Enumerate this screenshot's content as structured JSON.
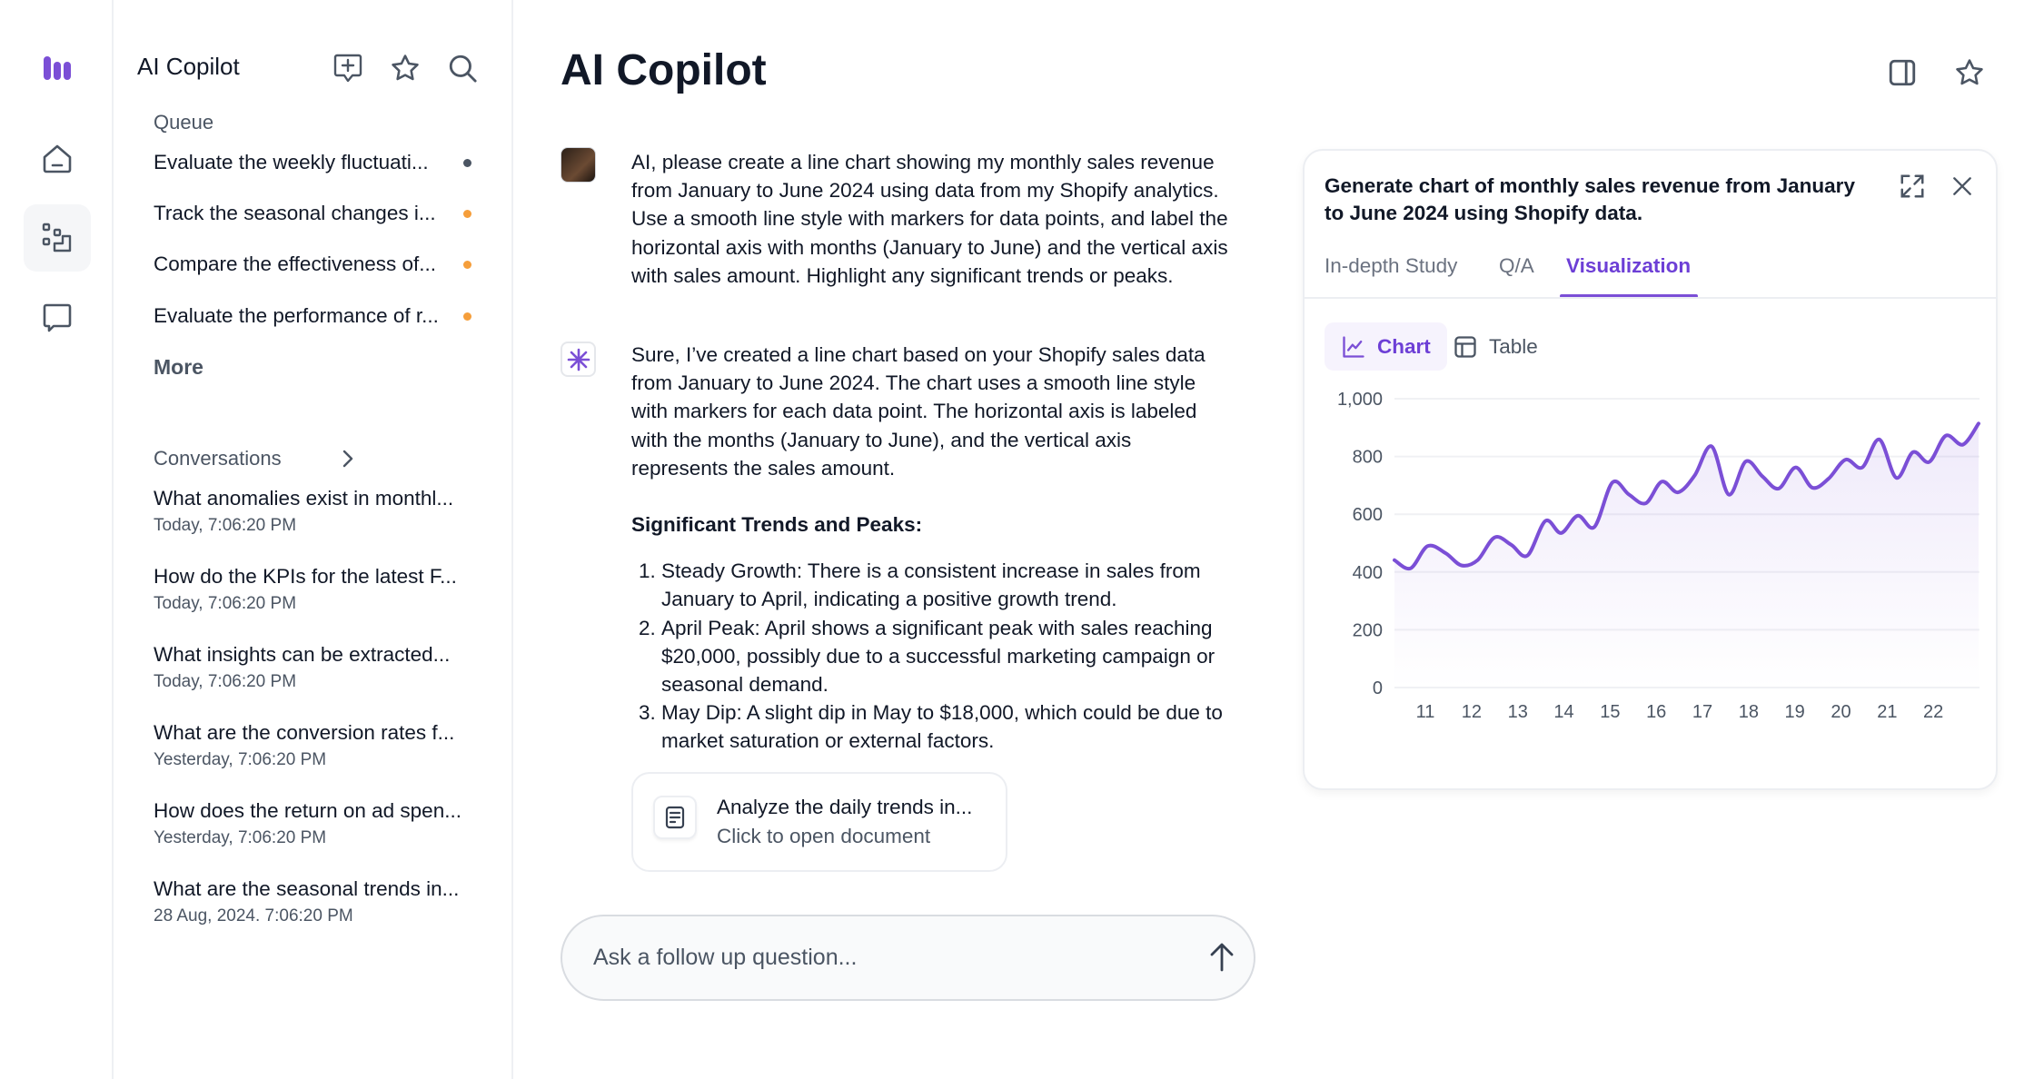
{
  "rail": {
    "items": [
      {
        "icon": "logo-bars-icon"
      },
      {
        "icon": "home-icon"
      },
      {
        "icon": "workflow-icon",
        "selected": true
      },
      {
        "icon": "chat-icon"
      }
    ]
  },
  "sidebar": {
    "title": "AI Copilot",
    "queue_label": "Queue",
    "queue": [
      {
        "label": "Evaluate the weekly fluctuati...",
        "status_color": "#4b5563"
      },
      {
        "label": "Track the seasonal changes i...",
        "status_color": "#f59e3b"
      },
      {
        "label": "Compare the effectiveness of...",
        "status_color": "#f59e3b"
      },
      {
        "label": "Evaluate the performance of r...",
        "status_color": "#f59e3b"
      }
    ],
    "more_label": "More",
    "conversations_label": "Conversations",
    "conversations": [
      {
        "title": "What anomalies exist in monthl...",
        "date": "Today, 7:06:20 PM"
      },
      {
        "title": "How do the KPIs for the latest F...",
        "date": "Today, 7:06:20 PM"
      },
      {
        "title": "What insights can be extracted...",
        "date": "Today, 7:06:20 PM"
      },
      {
        "title": "What are the conversion rates f...",
        "date": "Yesterday, 7:06:20 PM"
      },
      {
        "title": "How does the return on ad spen...",
        "date": "Yesterday, 7:06:20 PM"
      },
      {
        "title": "What are the seasonal trends in...",
        "date": "28 Aug, 2024. 7:06:20 PM"
      }
    ]
  },
  "main": {
    "title": "AI Copilot",
    "user_message": "AI, please create a line chart showing my monthly sales revenue from January to June 2024 using data from my Shopify analytics. Use a smooth line style with markers for data points, and label the horizontal axis with months (January to June) and the vertical axis with sales amount. Highlight any significant trends or peaks.",
    "bot_message": "Sure, I’ve created a line chart based on your Shopify sales data from January to June 2024. The chart uses a smooth line style with markers for each data point. The horizontal axis is labeled with the months (January to June), and the vertical axis represents the sales amount.",
    "trends_heading": "Significant Trends and Peaks:",
    "trends": [
      "Steady Growth: There is a consistent increase in sales from January to April, indicating a positive growth trend.",
      "April Peak: April shows a significant peak with sales reaching $20,000, possibly due to a successful marketing campaign or seasonal demand.",
      "May Dip: A slight dip in May to $18,000, which could be due to market saturation or external factors."
    ],
    "doc_card": {
      "title": "Analyze the daily trends in...",
      "subtitle": "Click to open document"
    },
    "input_placeholder": "Ask a follow up question..."
  },
  "panel": {
    "title": "Generate chart of monthly sales revenue from January to June 2024 using Shopify data.",
    "tabs": [
      {
        "label": "In-depth Study"
      },
      {
        "label": "Q/A"
      },
      {
        "label": "Visualization",
        "active": true
      }
    ],
    "view_toggle": [
      {
        "label": "Chart",
        "active": true
      },
      {
        "label": "Table"
      }
    ],
    "accent": "#7b4fd6"
  },
  "chart_data": {
    "type": "line",
    "title": "",
    "xlabel": "",
    "ylabel": "",
    "x": [
      10.33,
      10.68,
      11.05,
      11.44,
      11.78,
      12.13,
      12.5,
      12.86,
      13.21,
      13.6,
      13.94,
      14.3,
      14.66,
      15.05,
      15.41,
      15.77,
      16.12,
      16.47,
      16.83,
      17.2,
      17.57,
      17.94,
      18.3,
      18.65,
      19.02,
      19.38,
      19.73,
      20.1,
      20.46,
      20.83,
      21.2,
      21.56,
      21.91,
      22.27,
      22.64,
      22.98
    ],
    "y": [
      441,
      413,
      490,
      465,
      423,
      441,
      520,
      494,
      457,
      577,
      535,
      595,
      556,
      710,
      668,
      638,
      713,
      676,
      734,
      835,
      668,
      783,
      731,
      689,
      762,
      692,
      723,
      789,
      762,
      859,
      726,
      815,
      781,
      872,
      841,
      914
    ],
    "xticks": [
      "11",
      "12",
      "13",
      "14",
      "15",
      "16",
      "17",
      "18",
      "19",
      "20",
      "21",
      "22"
    ],
    "yticks": [
      "0",
      "200",
      "400",
      "600",
      "800",
      "1,000"
    ],
    "xlim": [
      10.33,
      23
    ],
    "ylim": [
      0,
      1000
    ],
    "grid": true,
    "smooth": true,
    "area_fill": true,
    "color": "#7b4fd6"
  }
}
